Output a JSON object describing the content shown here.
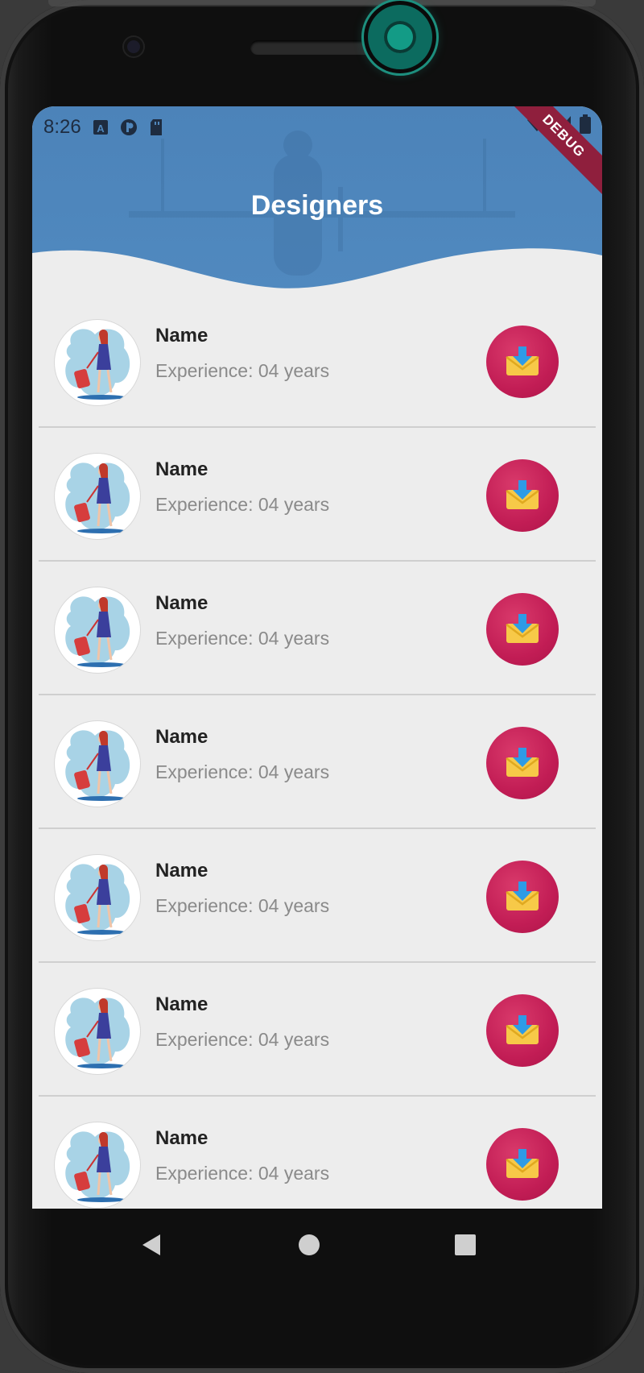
{
  "status_bar": {
    "time": "8:26"
  },
  "app_bar": {
    "title": "Designers",
    "debug_label": "DEBUG"
  },
  "designers": [
    {
      "name": "Name",
      "experience": "Experience: 04 years"
    },
    {
      "name": "Name",
      "experience": "Experience: 04 years"
    },
    {
      "name": "Name",
      "experience": "Experience: 04 years"
    },
    {
      "name": "Name",
      "experience": "Experience: 04 years"
    },
    {
      "name": "Name",
      "experience": "Experience: 04 years"
    },
    {
      "name": "Name",
      "experience": "Experience: 04 years"
    },
    {
      "name": "Name",
      "experience": "Experience: 04 years"
    }
  ],
  "icons": {
    "row_action": "download-mail-icon",
    "avatar": "traveler-woman-avatar",
    "nav": [
      "back-icon",
      "home-icon",
      "recents-icon"
    ]
  },
  "colors": {
    "header": "#4f86bb",
    "action_button": "#c21d55",
    "background": "#ededed",
    "debug_banner": "#8f1f3d"
  }
}
